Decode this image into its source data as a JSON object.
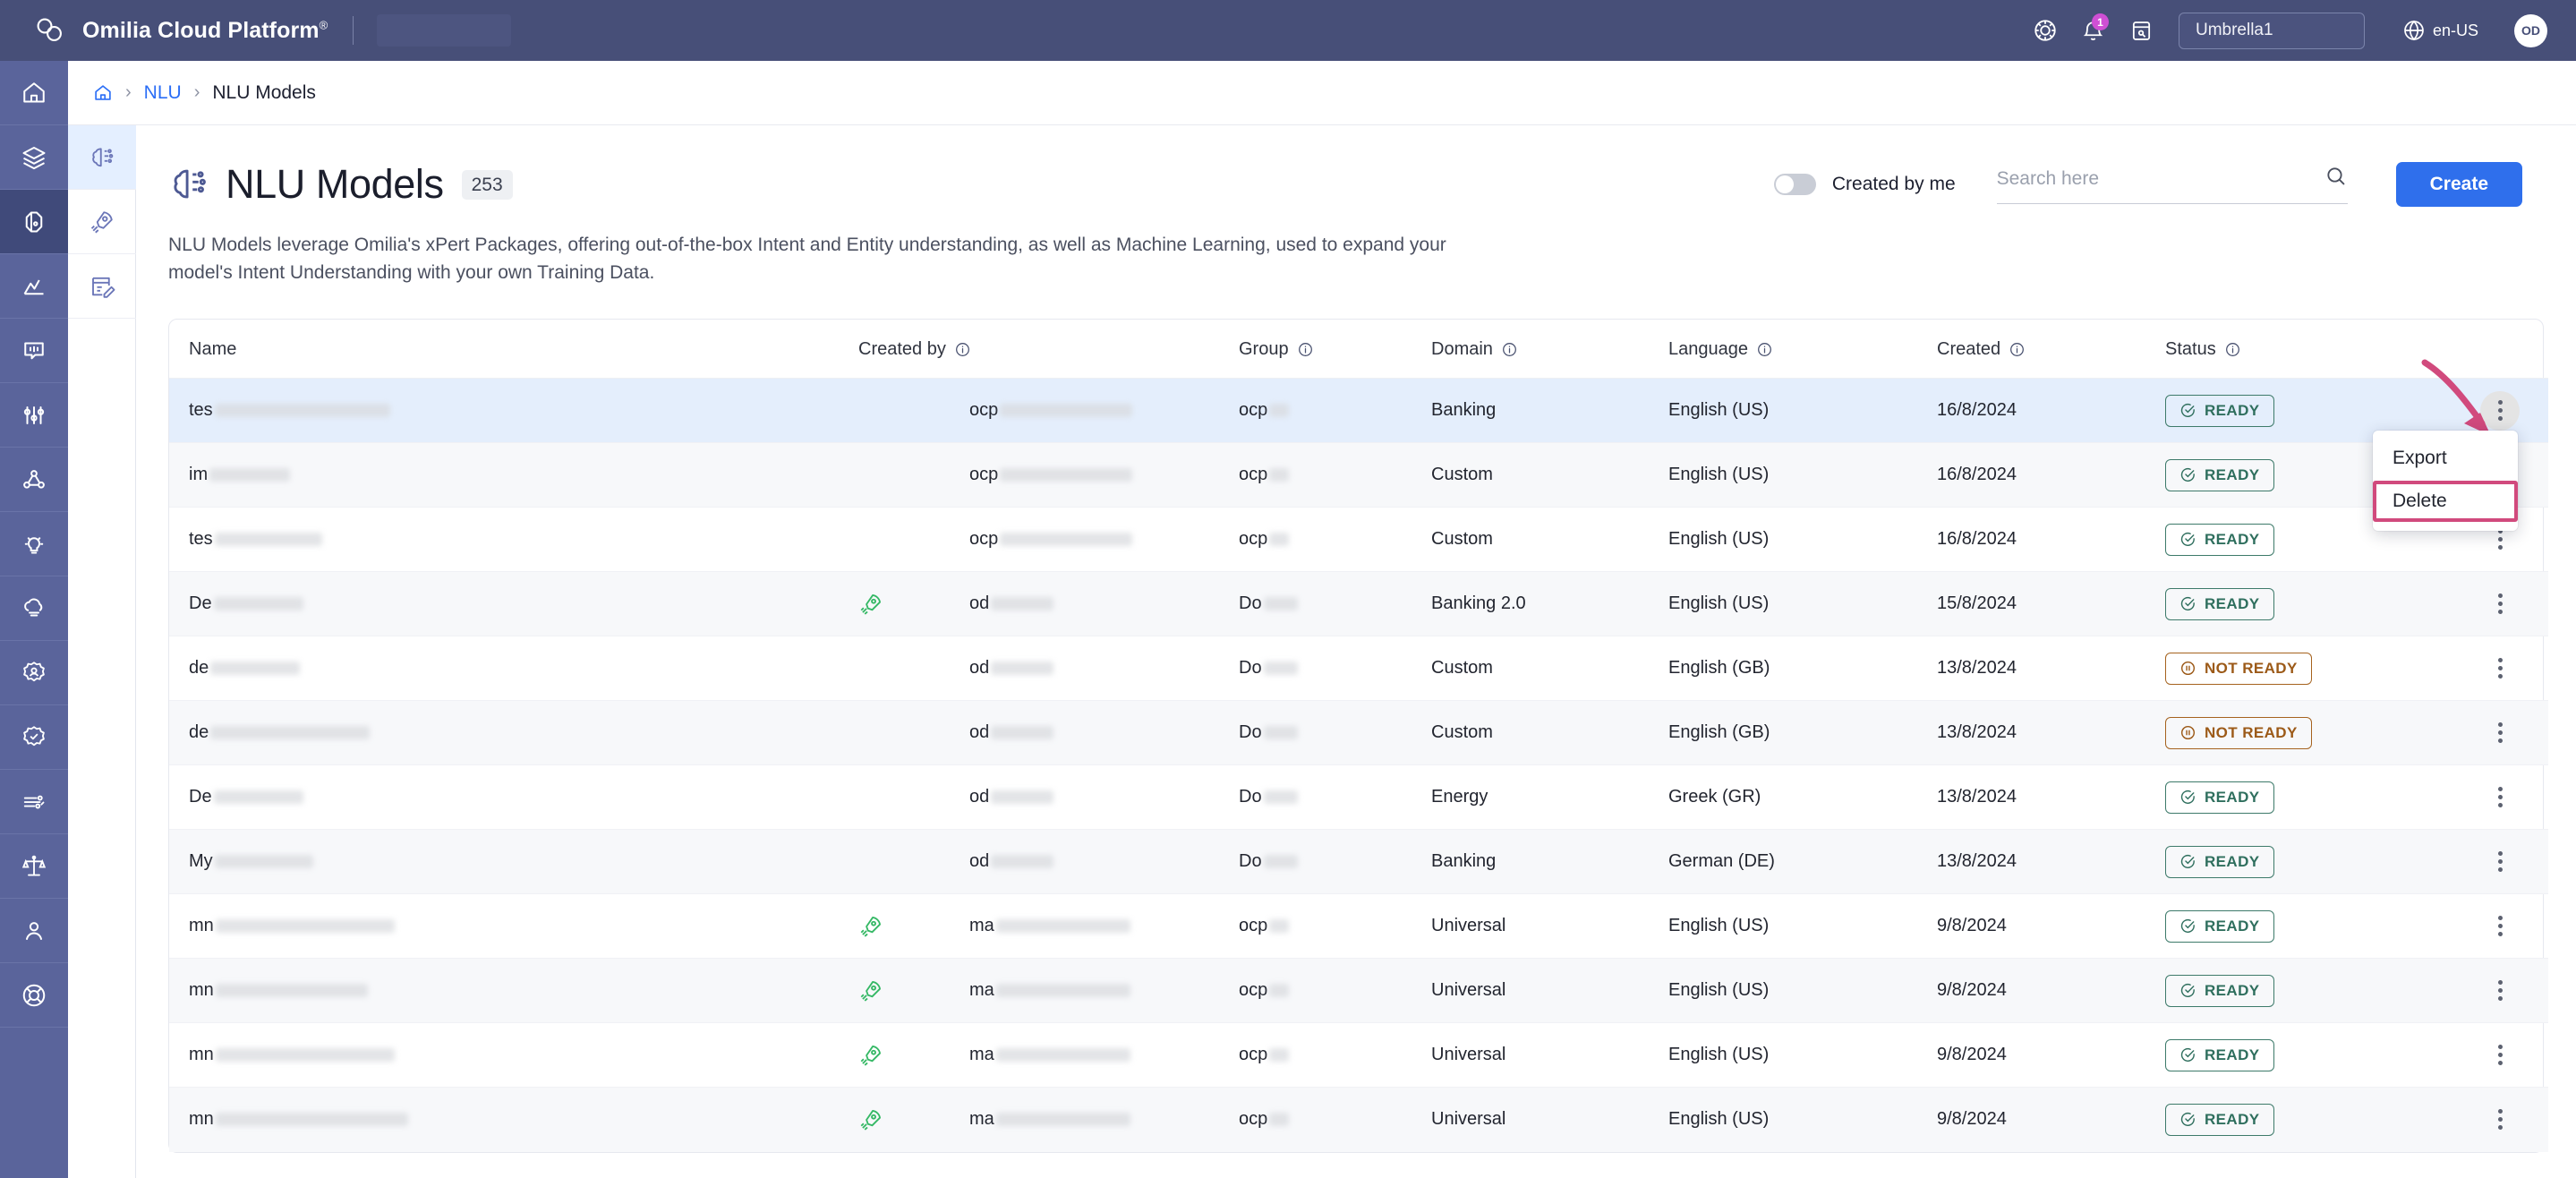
{
  "topbar": {
    "brand": "Omilia Cloud Platform",
    "brand_mark": "®",
    "notification_count": "1",
    "tenant": "Umbrella1",
    "language": "en-US",
    "avatar_initials": "OD",
    "icons": [
      "theme-icon",
      "notifications-icon",
      "notes-icon",
      "globe-icon"
    ]
  },
  "rail": {
    "items": [
      {
        "name": "home",
        "active": false
      },
      {
        "name": "layers",
        "active": false
      },
      {
        "name": "nlu",
        "active": true
      },
      {
        "name": "analytics",
        "active": false
      },
      {
        "name": "dialog",
        "active": false
      },
      {
        "name": "tuning",
        "active": false
      },
      {
        "name": "graph",
        "active": false
      },
      {
        "name": "insights",
        "active": false
      },
      {
        "name": "cloud",
        "active": false
      },
      {
        "name": "identity",
        "active": false
      },
      {
        "name": "verification",
        "active": false
      },
      {
        "name": "services",
        "active": false
      },
      {
        "name": "compliance",
        "active": false
      },
      {
        "name": "user",
        "active": false
      },
      {
        "name": "support",
        "active": false
      }
    ]
  },
  "subrail": {
    "items": [
      {
        "name": "nlu-models",
        "active": true
      },
      {
        "name": "deployments",
        "active": false
      },
      {
        "name": "annotations",
        "active": false
      }
    ]
  },
  "breadcrumb": {
    "home_icon": "home-icon",
    "sep": "›",
    "link": "NLU",
    "current": "NLU Models"
  },
  "page": {
    "title": "NLU Models",
    "count": "253",
    "description": "NLU Models leverage Omilia's xPert Packages, offering out-of-the-box Intent and Entity understanding, as well as Machine Learning, used to expand your model's Intent Understanding with your own Training Data."
  },
  "toolbar": {
    "toggle_label": "Created by me",
    "toggle_on": false,
    "search_placeholder": "Search here",
    "search_value": "",
    "create_label": "Create"
  },
  "table": {
    "columns": [
      {
        "label": "Name",
        "info": false,
        "cls": "c-name"
      },
      {
        "label": "Created by",
        "info": true,
        "cls": "c-cre"
      },
      {
        "label": "Group",
        "info": true,
        "cls": "c-grp"
      },
      {
        "label": "Domain",
        "info": true,
        "cls": "c-dom"
      },
      {
        "label": "Language",
        "info": true,
        "cls": "c-lang"
      },
      {
        "label": "Created",
        "info": true,
        "cls": "c-date"
      },
      {
        "label": "Status",
        "info": true,
        "cls": "c-stat"
      },
      {
        "label": "",
        "info": false,
        "cls": "c-act"
      }
    ],
    "rows": [
      {
        "name_prefix": "tes",
        "name_redact": 196,
        "rocket": false,
        "created_by_prefix": "ocp",
        "created_by_redact": 148,
        "group_prefix": "ocp",
        "group_redact": 22,
        "domain": "Banking",
        "language": "English (US)",
        "created": "16/8/2024",
        "status": "READY",
        "selected": true,
        "menu_open": true
      },
      {
        "name_prefix": "im",
        "name_redact": 90,
        "rocket": false,
        "created_by_prefix": "ocp",
        "created_by_redact": 148,
        "group_prefix": "ocp",
        "group_redact": 22,
        "domain": "Custom",
        "language": "English (US)",
        "created": "16/8/2024",
        "status": "READY",
        "selected": false,
        "menu_open": false
      },
      {
        "name_prefix": "tes",
        "name_redact": 120,
        "rocket": false,
        "created_by_prefix": "ocp",
        "created_by_redact": 148,
        "group_prefix": "ocp",
        "group_redact": 22,
        "domain": "Custom",
        "language": "English (US)",
        "created": "16/8/2024",
        "status": "READY",
        "selected": false,
        "menu_open": false
      },
      {
        "name_prefix": "De",
        "name_redact": 100,
        "rocket": true,
        "created_by_prefix": "od",
        "created_by_redact": 70,
        "group_prefix": "Do",
        "group_redact": 38,
        "domain": "Banking 2.0",
        "language": "English (US)",
        "created": "15/8/2024",
        "status": "READY",
        "selected": false,
        "menu_open": false
      },
      {
        "name_prefix": "de",
        "name_redact": 100,
        "rocket": false,
        "created_by_prefix": "od",
        "created_by_redact": 70,
        "group_prefix": "Do",
        "group_redact": 38,
        "domain": "Custom",
        "language": "English (GB)",
        "created": "13/8/2024",
        "status": "NOT READY",
        "selected": false,
        "menu_open": false
      },
      {
        "name_prefix": "de",
        "name_redact": 178,
        "rocket": false,
        "created_by_prefix": "od",
        "created_by_redact": 70,
        "group_prefix": "Do",
        "group_redact": 38,
        "domain": "Custom",
        "language": "English (GB)",
        "created": "13/8/2024",
        "status": "NOT READY",
        "selected": false,
        "menu_open": false
      },
      {
        "name_prefix": "De",
        "name_redact": 100,
        "rocket": false,
        "created_by_prefix": "od",
        "created_by_redact": 70,
        "group_prefix": "Do",
        "group_redact": 38,
        "domain": "Energy",
        "language": "Greek (GR)",
        "created": "13/8/2024",
        "status": "READY",
        "selected": false,
        "menu_open": false
      },
      {
        "name_prefix": "My",
        "name_redact": 110,
        "rocket": false,
        "created_by_prefix": "od",
        "created_by_redact": 70,
        "group_prefix": "Do",
        "group_redact": 38,
        "domain": "Banking",
        "language": "German (DE)",
        "created": "13/8/2024",
        "status": "READY",
        "selected": false,
        "menu_open": false
      },
      {
        "name_prefix": "mn",
        "name_redact": 200,
        "rocket": true,
        "created_by_prefix": "ma",
        "created_by_redact": 150,
        "group_prefix": "ocp",
        "group_redact": 22,
        "domain": "Universal",
        "language": "English (US)",
        "created": "9/8/2024",
        "status": "READY",
        "selected": false,
        "menu_open": false
      },
      {
        "name_prefix": "mn",
        "name_redact": 170,
        "rocket": true,
        "created_by_prefix": "ma",
        "created_by_redact": 150,
        "group_prefix": "ocp",
        "group_redact": 22,
        "domain": "Universal",
        "language": "English (US)",
        "created": "9/8/2024",
        "status": "READY",
        "selected": false,
        "menu_open": false
      },
      {
        "name_prefix": "mn",
        "name_redact": 200,
        "rocket": true,
        "created_by_prefix": "ma",
        "created_by_redact": 150,
        "group_prefix": "ocp",
        "group_redact": 22,
        "domain": "Universal",
        "language": "English (US)",
        "created": "9/8/2024",
        "status": "READY",
        "selected": false,
        "menu_open": false
      },
      {
        "name_prefix": "mn",
        "name_redact": 215,
        "rocket": true,
        "created_by_prefix": "ma",
        "created_by_redact": 150,
        "group_prefix": "ocp",
        "group_redact": 22,
        "domain": "Universal",
        "language": "English (US)",
        "created": "9/8/2024",
        "status": "READY",
        "selected": false,
        "menu_open": false
      }
    ]
  },
  "row_menu": {
    "items": [
      {
        "label": "Export",
        "highlight": false
      },
      {
        "label": "Delete",
        "highlight": true
      }
    ]
  },
  "annotation": {
    "arrow_color": "#d14a7d",
    "highlight_color": "#d14a7d"
  },
  "colors": {
    "topbar": "#474f78",
    "rail": "#5a649b",
    "accent": "#2f6fec",
    "ready": "#2f6f5e",
    "not_ready": "#9c5a18",
    "selected_row": "#e4eefc",
    "rocket": "#35b865"
  }
}
